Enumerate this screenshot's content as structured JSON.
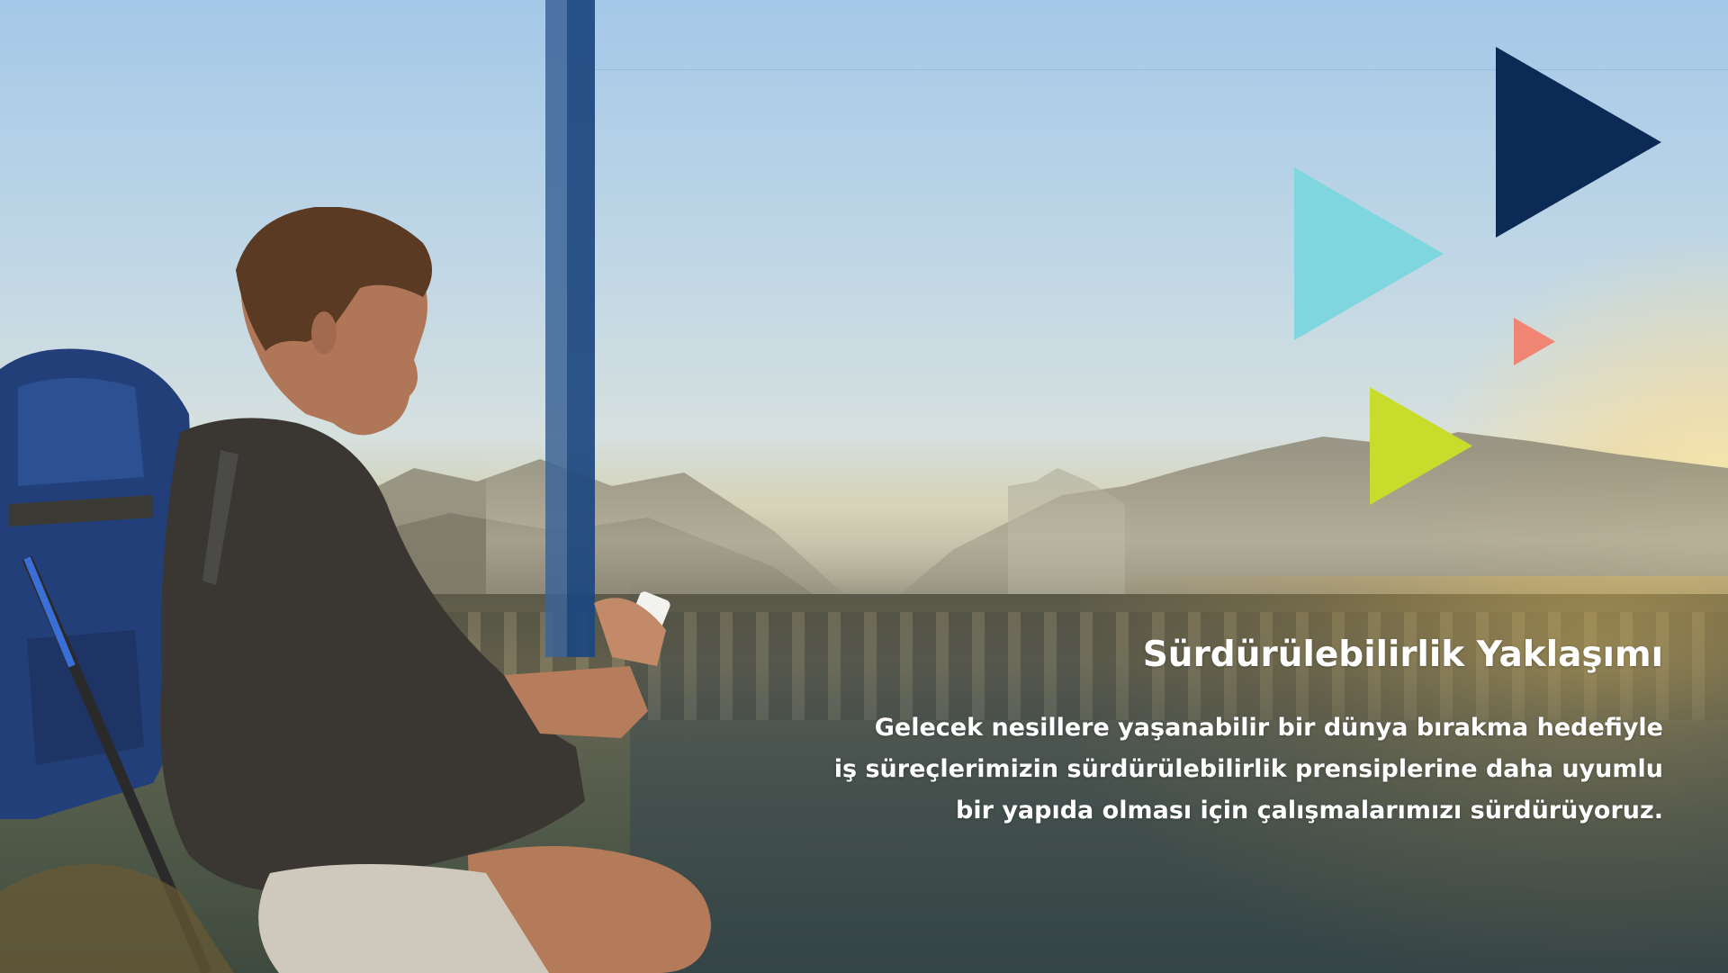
{
  "hero": {
    "title": "Sürdürülebilirlik Yaklaşımı",
    "body_lines": [
      "Gelecek nesillere yaşanabilir bir dünya bırakma hedefiyle",
      "iş süreçlerimizin sürdürülebilirlik prensiplerine daha uyumlu",
      "bir yapıda olması için çalışmalarımızı sürdürüyoruz."
    ]
  },
  "colors": {
    "navy_triangle": "#0b2a55",
    "cyan_triangle": "#7fd6df",
    "salmon_triangle": "#f08573",
    "lime_triangle": "#c8dc2c",
    "accent_bar": "#1c4680"
  },
  "icons": {
    "play_large": "play-triangle-icon",
    "decorative": "triangle-shapes"
  }
}
